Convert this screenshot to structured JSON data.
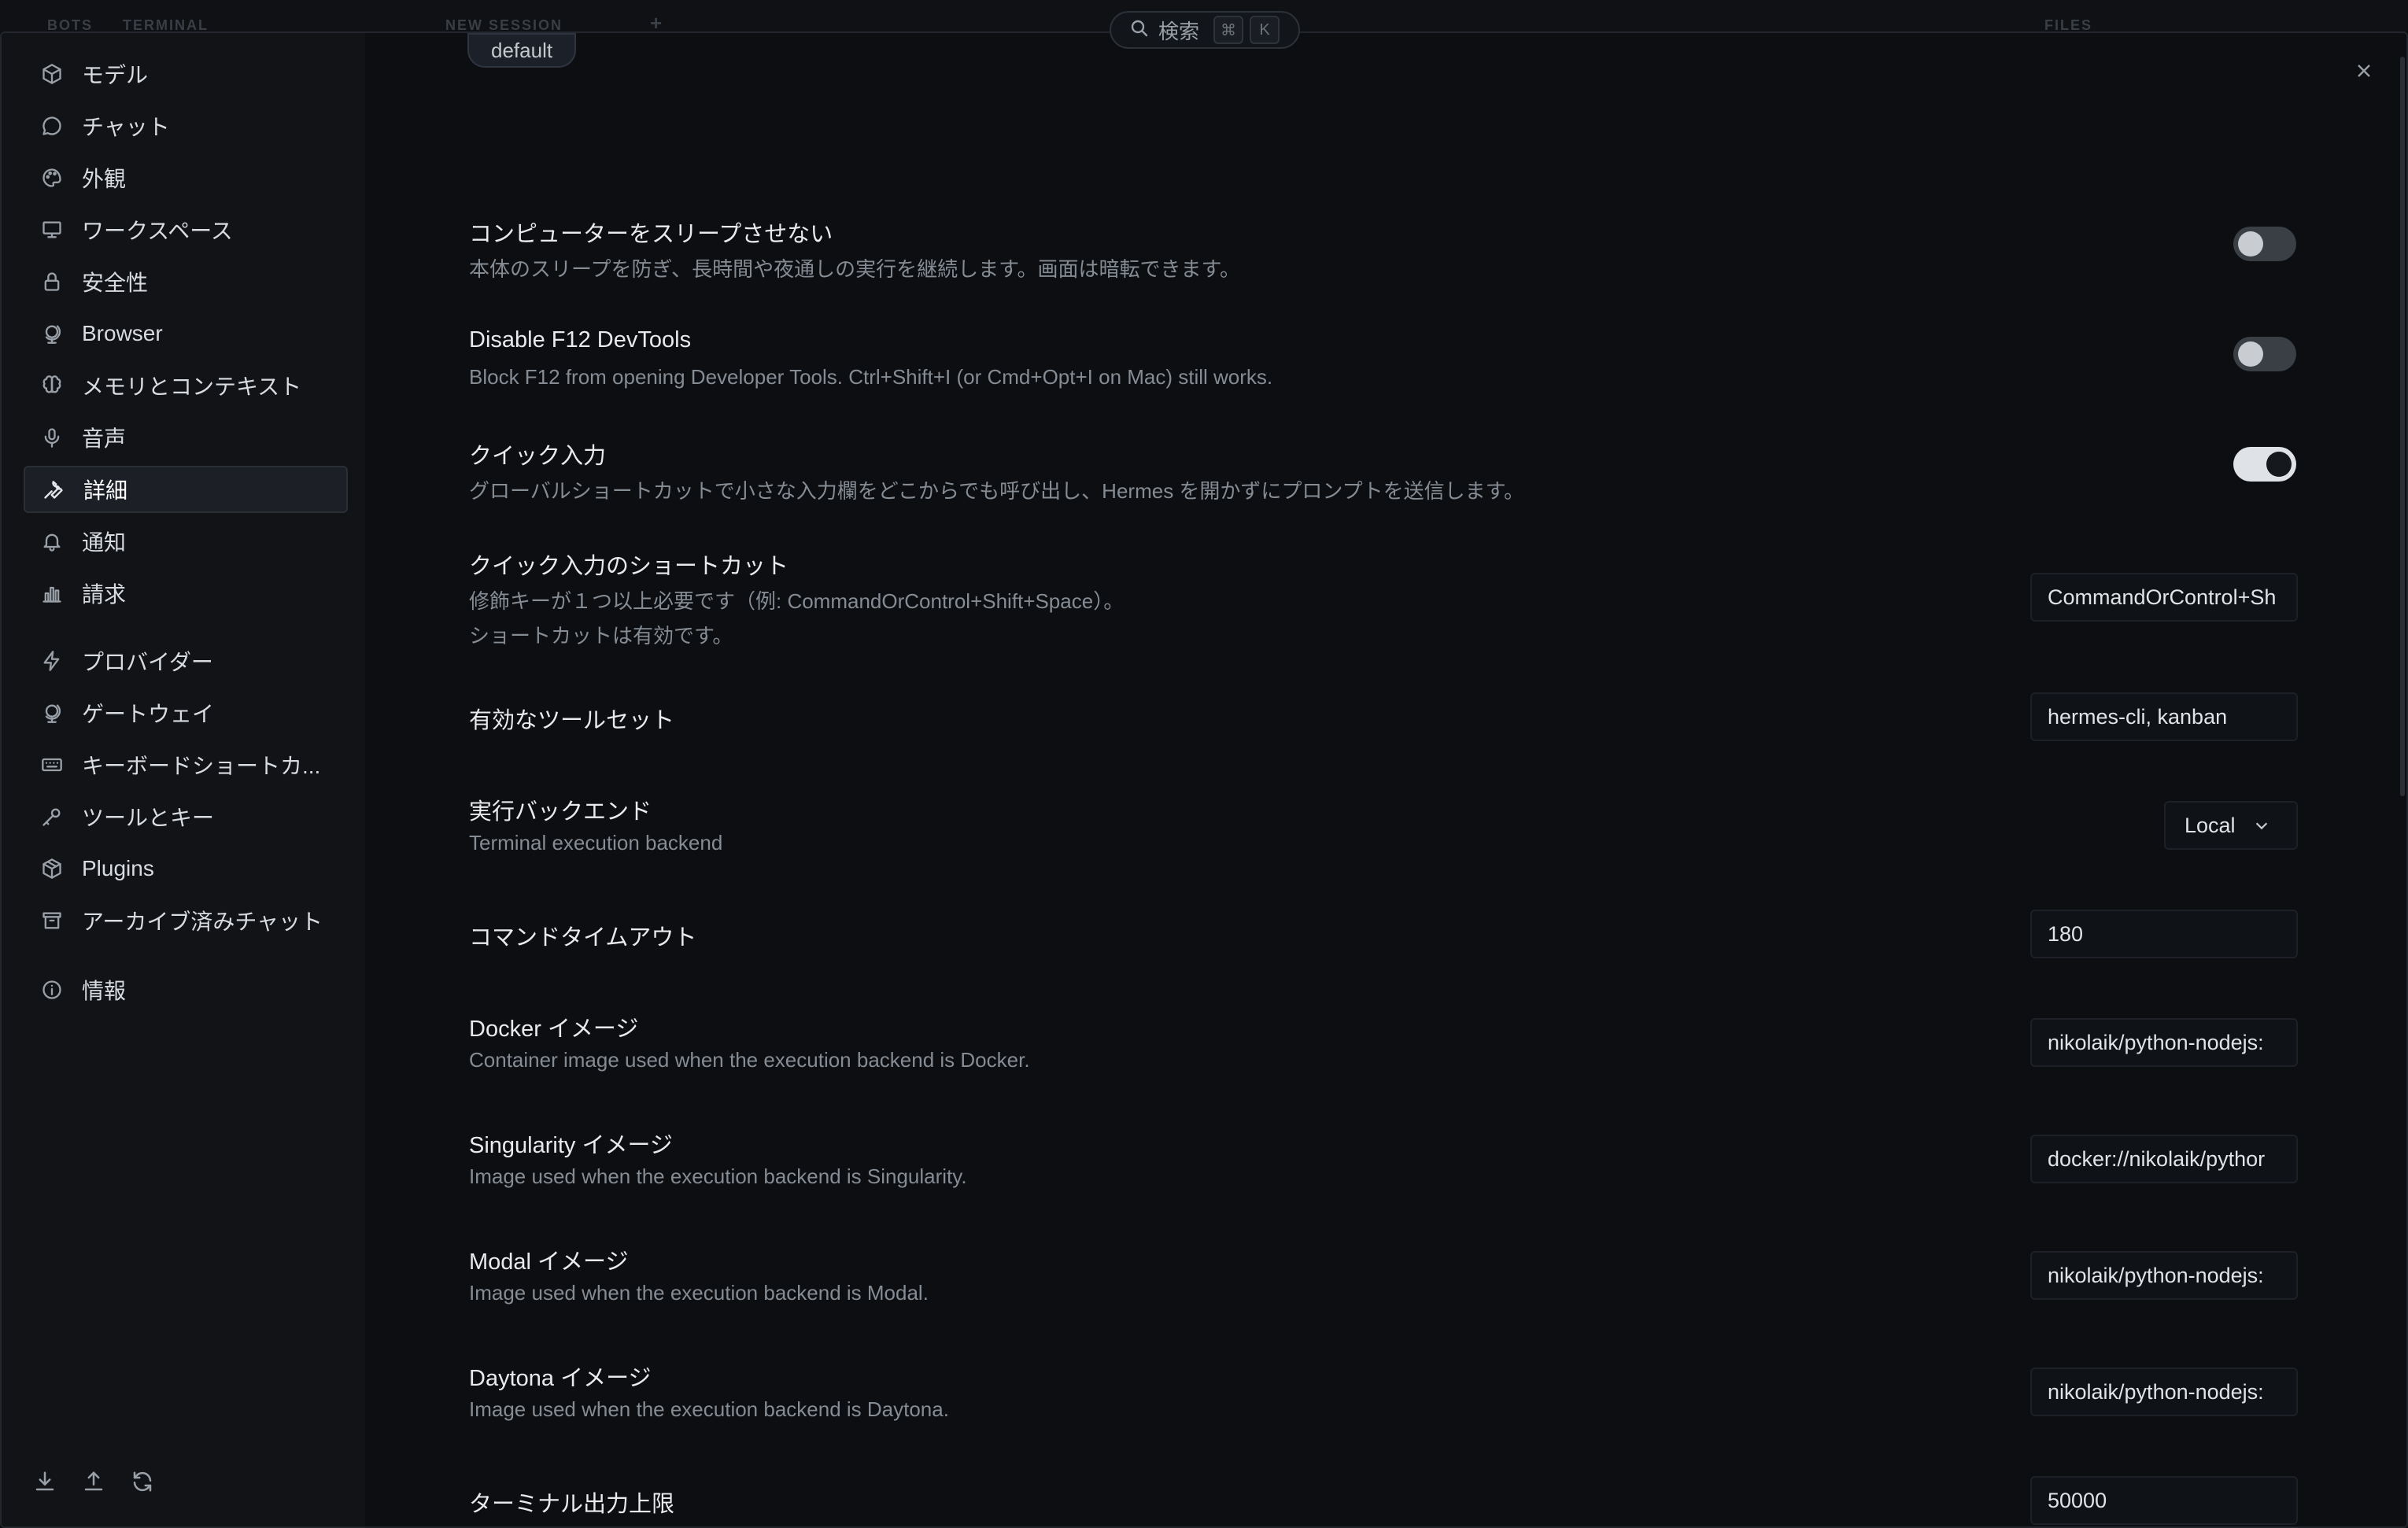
{
  "topbar": {
    "ghost_tabs": [
      "BOTS",
      "TERMINAL",
      "NEW SESSION",
      "+",
      "FILES"
    ],
    "search_label": "検索",
    "search_shortcut_cmd": "⌘",
    "search_shortcut_key": "K"
  },
  "sidebar": {
    "items": [
      {
        "label": "モデル",
        "icon": "cube-icon"
      },
      {
        "label": "チャット",
        "icon": "chat-bubble-icon"
      },
      {
        "label": "外観",
        "icon": "palette-icon"
      },
      {
        "label": "ワークスペース",
        "icon": "monitor-icon"
      },
      {
        "label": "安全性",
        "icon": "lock-icon"
      },
      {
        "label": "Browser",
        "icon": "globe-stand-icon"
      },
      {
        "label": "メモリとコンテキスト",
        "icon": "brain-icon"
      },
      {
        "label": "音声",
        "icon": "microphone-icon"
      },
      {
        "label": "詳細",
        "icon": "wrench-icon",
        "active": true
      },
      {
        "label": "通知",
        "icon": "bell-icon"
      },
      {
        "label": "請求",
        "icon": "bar-chart-icon"
      },
      {
        "label": "プロバイダー",
        "icon": "lightning-icon"
      },
      {
        "label": "ゲートウェイ",
        "icon": "globe-stand-icon"
      },
      {
        "label": "キーボードショートカ...",
        "icon": "keyboard-icon"
      },
      {
        "label": "ツールとキー",
        "icon": "key-icon"
      },
      {
        "label": "Plugins",
        "icon": "package-icon"
      },
      {
        "label": "アーカイブ済みチャット",
        "icon": "archive-icon"
      },
      {
        "label": "情報",
        "icon": "info-icon"
      }
    ],
    "bottom_icons": [
      "download-icon",
      "upload-icon",
      "refresh-icon"
    ]
  },
  "content": {
    "profile_chip": "default",
    "settings": {
      "no_sleep": {
        "title": "コンピューターをスリープさせない",
        "desc": "本体のスリープを防ぎ、長時間や夜通しの実行を継続します。画面は暗転できます。",
        "enabled": false
      },
      "disable_f12": {
        "title": "Disable F12 DevTools",
        "desc": "Block F12 from opening Developer Tools. Ctrl+Shift+I (or Cmd+Opt+I on Mac) still works.",
        "enabled": false
      },
      "quick_input": {
        "title": "クイック入力",
        "desc": "グローバルショートカットで小さな入力欄をどこからでも呼び出し、Hermes を開かずにプロンプトを送信します。",
        "enabled": true
      },
      "quick_shortcut": {
        "title": "クイック入力のショートカット",
        "desc1": "修飾キーが１つ以上必要です（例: CommandOrControl+Shift+Space）。",
        "desc2": "ショートカットは有効です。",
        "value": "CommandOrControl+Sh"
      },
      "toolsets": {
        "title": "有効なツールセット",
        "value": "hermes-cli, kanban"
      },
      "backend": {
        "title": "実行バックエンド",
        "desc": "Terminal execution backend",
        "value": "Local"
      },
      "timeout": {
        "title": "コマンドタイムアウト",
        "value": "180"
      },
      "docker": {
        "title": "Docker イメージ",
        "desc": "Container image used when the execution backend is Docker.",
        "value": "nikolaik/python-nodejs:"
      },
      "singularity": {
        "title": "Singularity イメージ",
        "desc": "Image used when the execution backend is Singularity.",
        "value": "docker://nikolaik/pythor"
      },
      "modal": {
        "title": "Modal イメージ",
        "desc": "Image used when the execution backend is Modal.",
        "value": "nikolaik/python-nodejs:"
      },
      "daytona": {
        "title": "Daytona イメージ",
        "desc": "Image used when the execution backend is Daytona.",
        "value": "nikolaik/python-nodejs:"
      },
      "output_limit": {
        "title": "ターミナル出力上限",
        "value": "50000"
      }
    }
  }
}
